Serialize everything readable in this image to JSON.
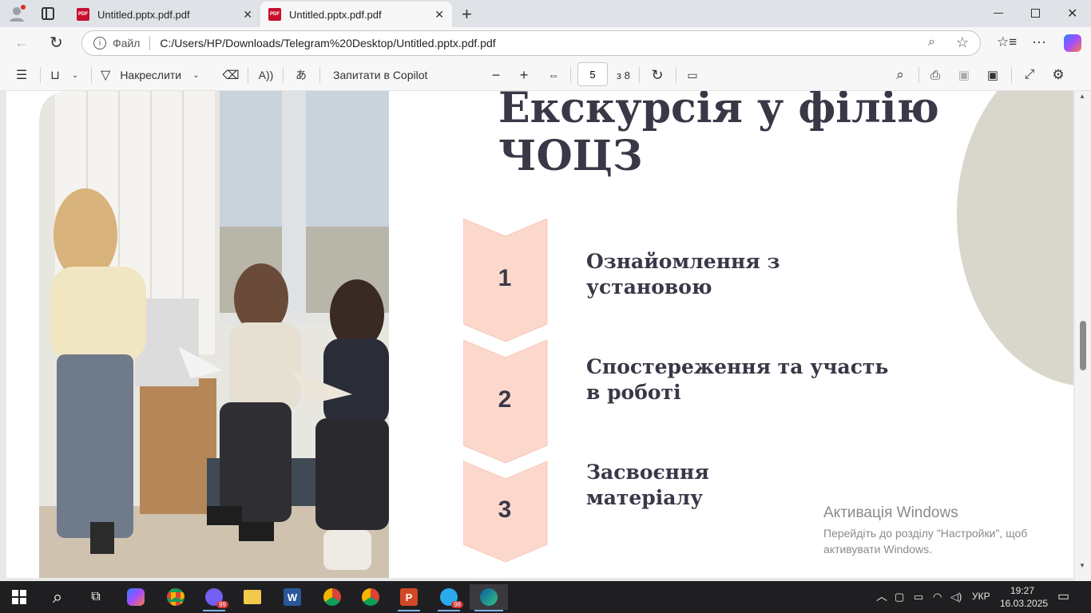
{
  "browser": {
    "tabs": [
      {
        "title": "Untitled.pptx.pdf.pdf",
        "active": false
      },
      {
        "title": "Untitled.pptx.pdf.pdf",
        "active": true
      }
    ],
    "address": {
      "scheme_label": "Файл",
      "url": "C:/Users/HP/Downloads/Telegram%20Desktop/Untitled.pptx.pdf.pdf"
    }
  },
  "pdf_toolbar": {
    "draw_label": "Накреслити",
    "copilot_label": "Запитати в Copilot",
    "page_current": "5",
    "page_total_label": "з 8"
  },
  "slide": {
    "title_line1": "Екскурсія у філію",
    "title_line2": "ЧОЦЗ",
    "steps": [
      {
        "number": "1",
        "line1": "Ознайомлення з",
        "line2": "установою"
      },
      {
        "number": "2",
        "line1": "Спостереження та участь",
        "line2": "в роботі"
      },
      {
        "number": "3",
        "line1": "Засвоєння",
        "line2": "матеріалу"
      }
    ],
    "colors": {
      "chevron": "#fcd8cc",
      "text": "#3a3847",
      "circle": "#d9d6cc"
    }
  },
  "watermark": {
    "title": "Активація Windows",
    "line1": "Перейдіть до розділу \"Настройки\", щоб",
    "line2": "активувати Windows."
  },
  "taskbar": {
    "viber_badge": "99",
    "telegram_badge": "98",
    "language": "УКР",
    "time": "19:27",
    "date": "16.03.2025"
  }
}
